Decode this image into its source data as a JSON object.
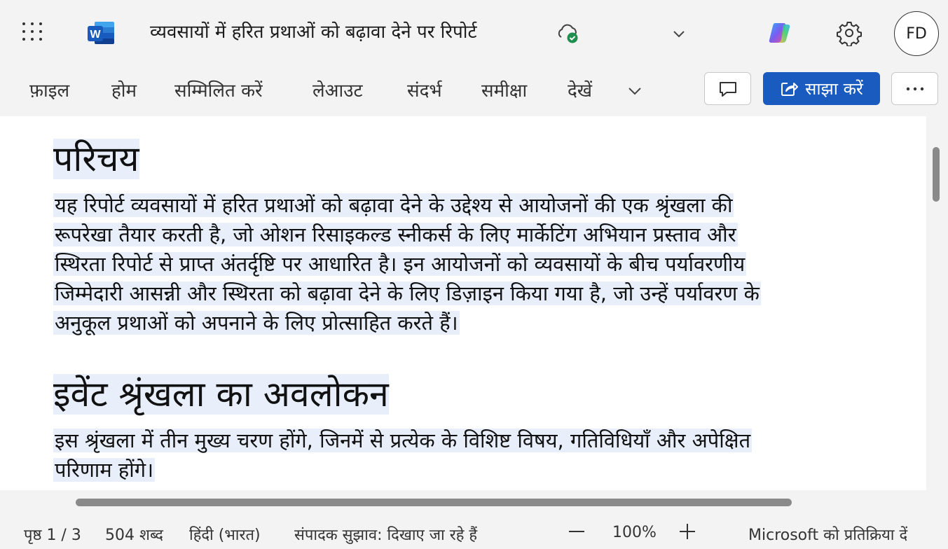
{
  "app": {
    "document_title": "व्यवसायों में हरित प्रथाओं को बढ़ावा देने पर रिपोर्ट",
    "user_initials": "FD",
    "icons": {
      "apps": "waffle-grid-icon",
      "app_logo": "word-logo",
      "save_status": "cloud-saved-icon",
      "title_menu": "chevron-down-icon",
      "copilot": "copilot-icon",
      "settings": "gear-icon"
    }
  },
  "ribbon": {
    "tabs": [
      "फ़ाइल",
      "होम",
      "सम्मिलित करें",
      "लेआउट",
      "संदर्भ",
      "समीक्षा",
      "देखें"
    ],
    "share_label": "साझा करें",
    "comment_icon": "comment-icon",
    "more_icon": "more-horizontal-icon",
    "share_color": "#1a5bbf"
  },
  "document": {
    "sections": [
      {
        "heading": "परिचय",
        "paragraph_lines": [
          "यह रिपोर्ट व्यवसायों में हरित प्रथाओं को बढ़ावा देने के उद्देश्य से आयोजनों की एक श्रृंखला की",
          "रूपरेखा तैयार करती है, जो ओशन रिसाइकल्ड स्नीकर्स के लिए मार्केटिंग अभियान प्रस्ताव और",
          "स्थिरता रिपोर्ट से प्राप्त अंतर्दृष्टि पर आधारित है। इन आयोजनों को व्यवसायों के बीच पर्यावरणीय",
          "जिम्मेदारी आसन्नी और स्थिरता को बढ़ावा देने के लिए डिज़ाइन किया गया है, जो उन्हें पर्यावरण के",
          "अनुकूल प्रथाओं को अपनाने के लिए प्रोत्साहित करते हैं।"
        ]
      },
      {
        "heading": "इवेंट श्रृंखला का अवलोकन",
        "paragraph_lines": [
          "इस श्रृंखला में तीन मुख्य चरण होंगे, जिनमें से प्रत्येक के विशिष्ट विषय, गतिविधियाँ और अपेक्षित",
          "परिणाम होंगे।"
        ]
      }
    ],
    "selection_color": "#e8effb"
  },
  "statusbar": {
    "page": "पृष्ठ 1 / 3",
    "words": "504 शब्द",
    "language": "हिंदी (भारत)",
    "editor": "संपादक सुझाव: दिखाए जा रहे हैं",
    "zoom": "100%",
    "feedback": "Microsoft को प्रतिक्रिया दें"
  }
}
